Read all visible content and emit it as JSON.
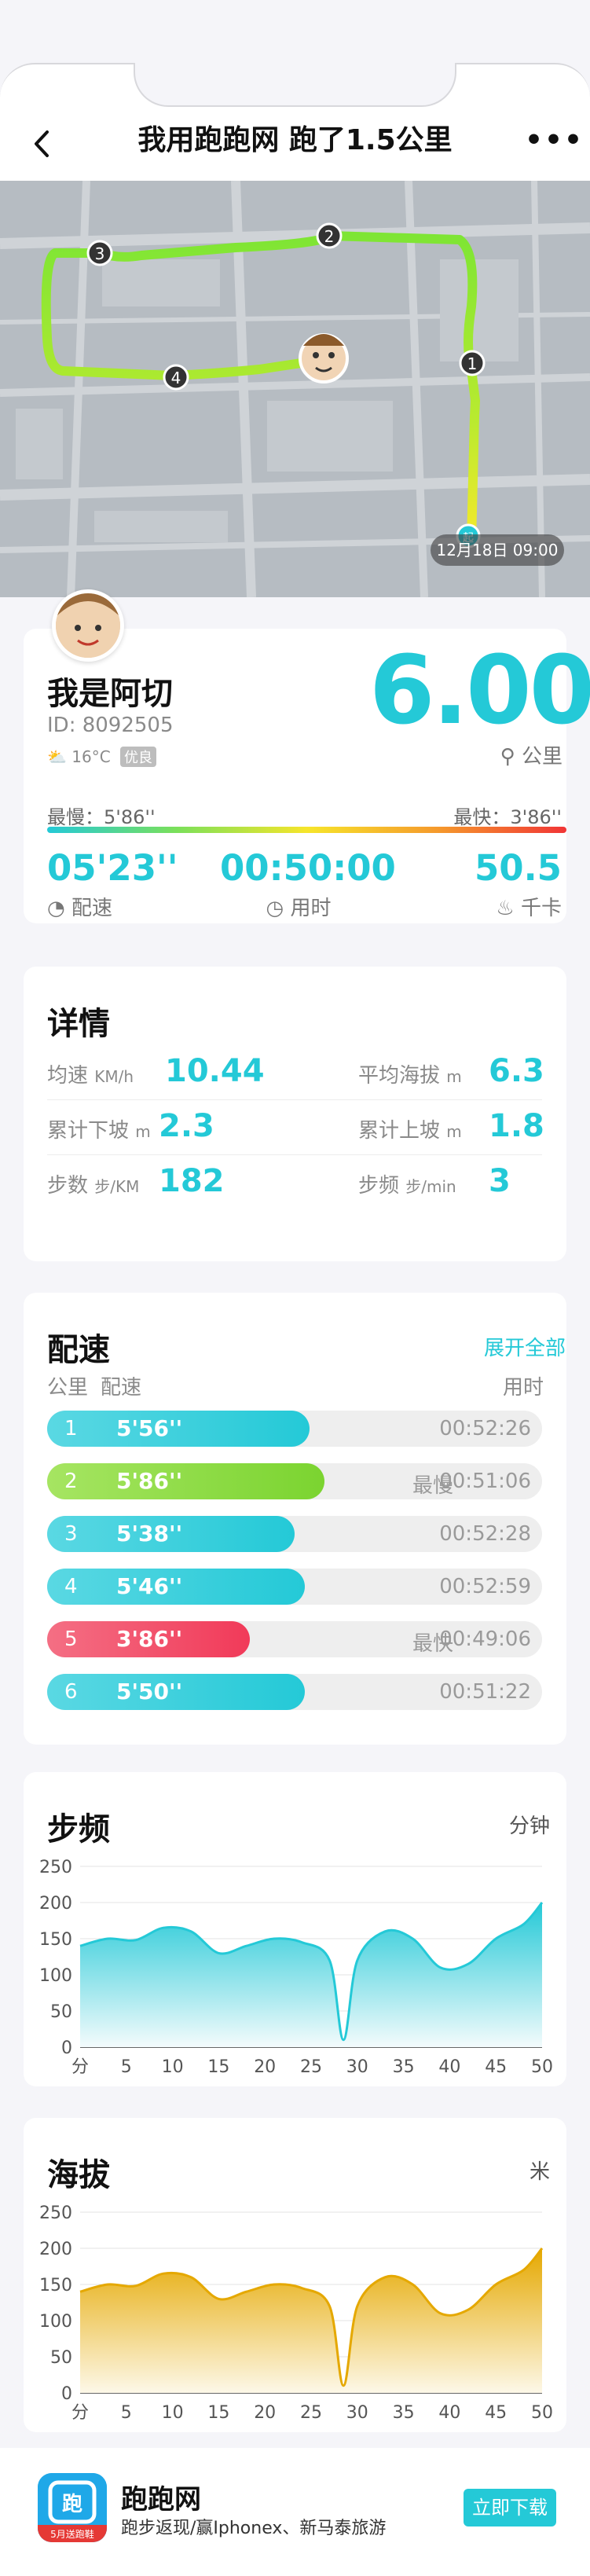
{
  "header": {
    "title": "我用跑跑网 跑了1.5公里",
    "back_icon": "chevron-left-icon",
    "more_label": "•••"
  },
  "map": {
    "timestamp": "12月18日 09:00",
    "markers": [
      "1",
      "2",
      "3",
      "4"
    ],
    "start_marker": "起"
  },
  "summary": {
    "username": "我是阿切",
    "user_id": "ID: 8092505",
    "weather_temp": "16°C",
    "aqi": "优良",
    "distance": "6.00",
    "distance_unit": "公里",
    "slowest": "最慢：5'86''",
    "fastest": "最快：3'86''",
    "stats": [
      {
        "value": "05'23''",
        "label": "配速",
        "icon": "gauge-icon"
      },
      {
        "value": "00:50:00",
        "label": "用时",
        "icon": "clock-icon"
      },
      {
        "value": "50.5",
        "label": "千卡",
        "icon": "flame-icon"
      }
    ],
    "colors": {
      "accent": "#24c9d7"
    }
  },
  "details": {
    "title": "详情",
    "rows": [
      {
        "left_label": "均速",
        "left_unit": "KM/h",
        "left_value": "10.44",
        "right_label": "平均海拔",
        "right_unit": "m",
        "right_value": "6.3"
      },
      {
        "left_label": "累计下坡",
        "left_unit": "m",
        "left_value": "2.3",
        "right_label": "累计上坡",
        "right_unit": "m",
        "right_value": "1.8"
      },
      {
        "left_label": "步数",
        "left_unit": "步/KM",
        "left_value": "182",
        "right_label": "步频",
        "right_unit": "步/min",
        "right_value": "3"
      }
    ]
  },
  "pace": {
    "title": "配速",
    "show_all": "展开全部",
    "col_km": "公里",
    "col_pace": "配速",
    "col_time": "用时",
    "rows": [
      {
        "index": "1",
        "pace": "5'56''",
        "tag": "",
        "time": "00:52:26",
        "fill": 0.53,
        "color": "#24c9d7"
      },
      {
        "index": "2",
        "pace": "5'86''",
        "tag": "最慢",
        "time": "00:51:06",
        "fill": 0.56,
        "color": "#7bd430"
      },
      {
        "index": "3",
        "pace": "5'38''",
        "tag": "",
        "time": "00:52:28",
        "fill": 0.5,
        "color": "#24c9d7"
      },
      {
        "index": "4",
        "pace": "5'46''",
        "tag": "",
        "time": "00:52:59",
        "fill": 0.52,
        "color": "#24c9d7"
      },
      {
        "index": "5",
        "pace": "3'86''",
        "tag": "最快",
        "time": "00:49:06",
        "fill": 0.41,
        "color": "#f13a59"
      },
      {
        "index": "6",
        "pace": "5'50''",
        "tag": "",
        "time": "00:51:22",
        "fill": 0.52,
        "color": "#24c9d7"
      }
    ]
  },
  "cadence_chart": {
    "title": "步频",
    "unit": "分钟",
    "chart_data": {
      "type": "area",
      "x_ticks": [
        "分",
        "5",
        "10",
        "15",
        "20",
        "25",
        "30",
        "35",
        "40",
        "45",
        "50"
      ],
      "y_ticks": [
        "250",
        "200",
        "150",
        "100",
        "50",
        "0"
      ],
      "ylim": [
        0,
        250
      ],
      "x": [
        0,
        3,
        6,
        9,
        12,
        15,
        18,
        21,
        24,
        27,
        28.5,
        30,
        33,
        36,
        39,
        42,
        45,
        48,
        50
      ],
      "values": [
        140,
        150,
        148,
        165,
        160,
        130,
        140,
        150,
        145,
        120,
        10,
        120,
        160,
        150,
        110,
        115,
        150,
        170,
        200
      ],
      "color": "#24c9d7"
    }
  },
  "altitude_chart": {
    "title": "海拔",
    "unit": "米",
    "chart_data": {
      "type": "area",
      "x_ticks": [
        "分",
        "5",
        "10",
        "15",
        "20",
        "25",
        "30",
        "35",
        "40",
        "45",
        "50"
      ],
      "y_ticks": [
        "250",
        "200",
        "150",
        "100",
        "50",
        "0"
      ],
      "ylim": [
        0,
        250
      ],
      "x": [
        0,
        3,
        6,
        9,
        12,
        15,
        18,
        21,
        24,
        27,
        28.5,
        30,
        33,
        36,
        39,
        42,
        45,
        48,
        50
      ],
      "values": [
        140,
        150,
        148,
        165,
        160,
        130,
        140,
        150,
        145,
        120,
        10,
        120,
        160,
        150,
        110,
        115,
        150,
        170,
        200
      ],
      "color": "#e5a800"
    }
  },
  "footer": {
    "app_name": "跑跑网",
    "slogan": "跑步返现/赢Iphonex、新马泰旅游",
    "download": "立即下载",
    "logo_caption": "5月送跑鞋"
  }
}
